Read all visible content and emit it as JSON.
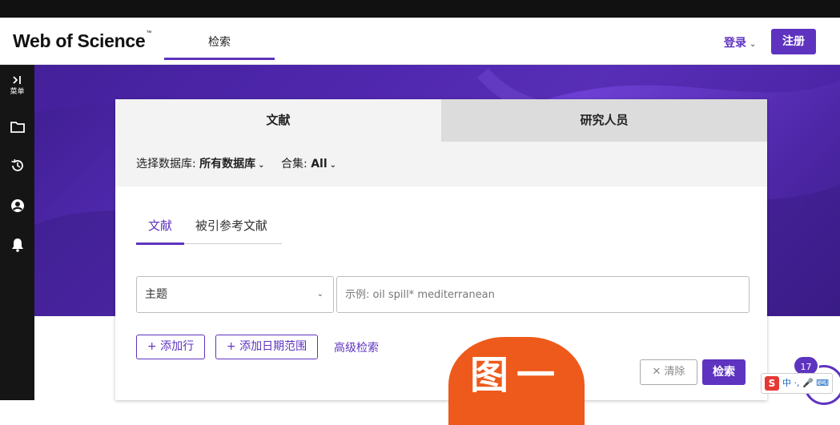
{
  "header": {
    "logo": "Web of Science",
    "logo_tm": "™",
    "nav_search": "检索",
    "login": "登录",
    "register": "注册"
  },
  "sidebar": {
    "menu_label": "菜单"
  },
  "search_card": {
    "tabs": [
      "文献",
      "研究人员"
    ],
    "db_label": "选择数据库:",
    "db_value": "所有数据库",
    "collection_label": "合集:",
    "collection_value": "All",
    "sub_tabs": [
      "文献",
      "被引参考文献"
    ],
    "field_select": "主题",
    "input_placeholder": "示例: oil spill* mediterranean",
    "add_row": "+ 添加行",
    "add_date_range": "+ 添加日期范围",
    "advanced_search": "高级检索",
    "clear": "✕ 清除",
    "search": "检索"
  },
  "overlay": {
    "stamp_text": "图一",
    "help_badge_count": "17",
    "ime_text": "中 ·, 🎤 ⌨"
  },
  "colors": {
    "accent": "#5e33bf",
    "stamp": "#ee5a1b"
  }
}
